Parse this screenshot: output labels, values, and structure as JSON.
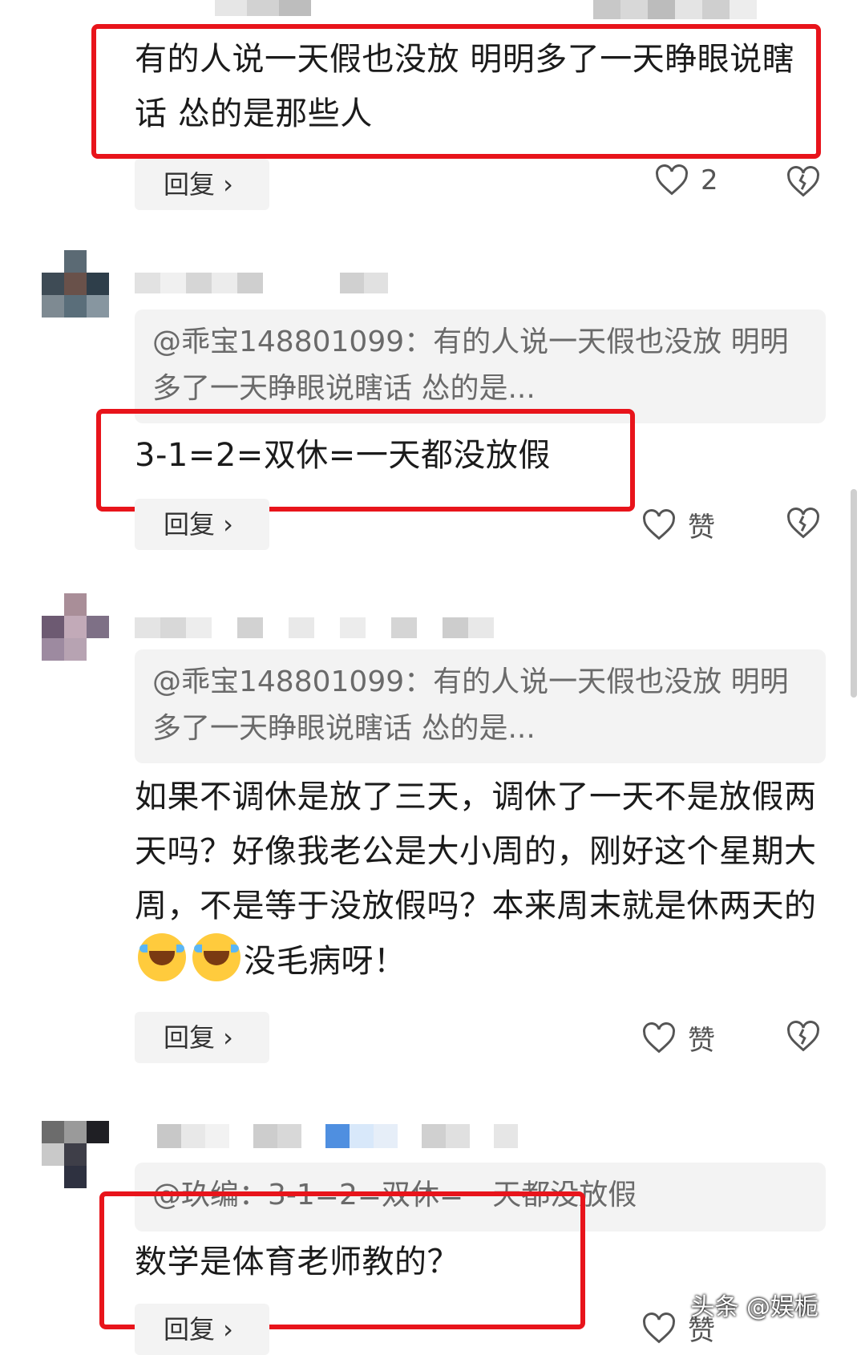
{
  "comments": [
    {
      "body": "有的人说一天假也没放 明明多了一天睁眼说瞎话 怂的是那些人",
      "reply_label": "回复 ›",
      "like_count": "2"
    },
    {
      "quote": "@乖宝148801099：有的人说一天假也没放 明明多了一天睁眼说瞎话 怂的是...",
      "body": "3-1=2=双休=一天都没放假",
      "reply_label": "回复 ›",
      "like_label": "赞"
    },
    {
      "quote": "@乖宝148801099：有的人说一天假也没放 明明多了一天睁眼说瞎话 怂的是...",
      "body_before_emoji": "如果不调休是放了三天，调休了一天不是放假两天吗？好像我老公是大小周的，刚好这个星期大周，不是等于没放假吗？本来周末就是休两天的",
      "emoji_icon": "laughing-crying-emoji",
      "body_after_emoji": "没毛病呀！",
      "reply_label": "回复 ›",
      "like_label": "赞"
    },
    {
      "quote": "@玖编：3-1=2=双休=一天都没放假",
      "body": "数学是体育老师教的？",
      "reply_label": "回复 ›",
      "like_label": "赞"
    }
  ],
  "watermark": "头条 @娱栀",
  "colors": {
    "highlight": "#e8141b",
    "quote_bg": "#f3f3f3"
  }
}
